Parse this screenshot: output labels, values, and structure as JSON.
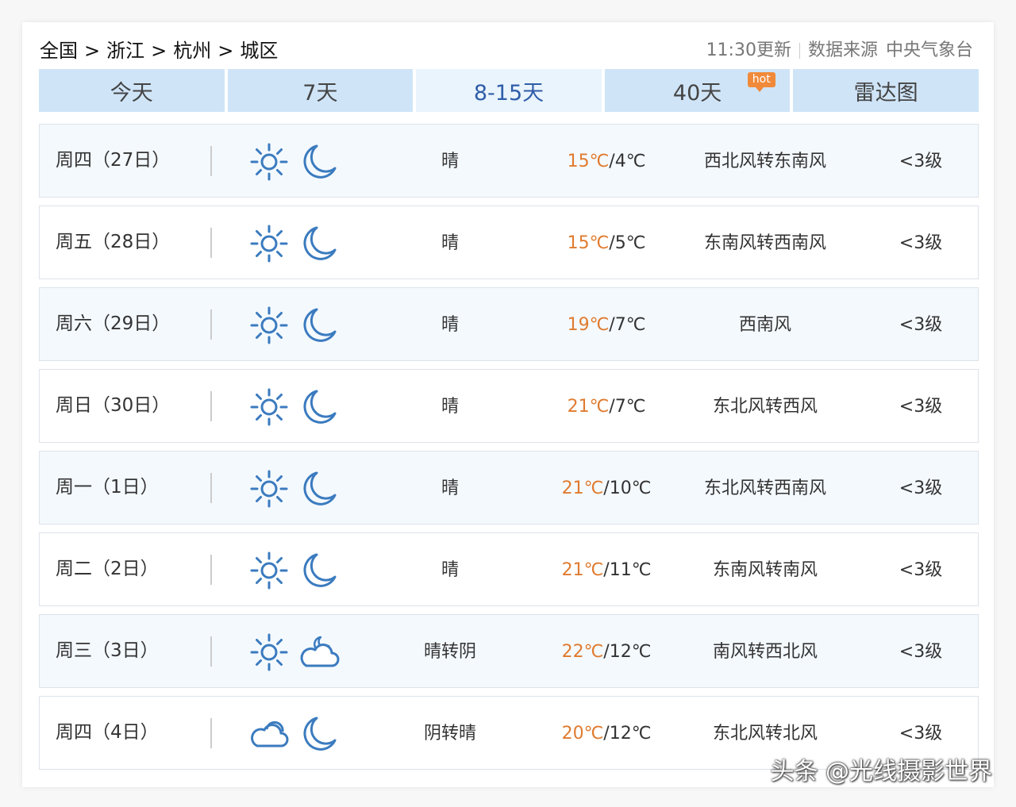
{
  "breadcrumb": {
    "items": [
      "全国",
      "浙江",
      "杭州",
      "城区"
    ],
    "separator": ">"
  },
  "source": {
    "updated": "11:30更新",
    "provider_label": "数据来源",
    "provider": "中央气象台"
  },
  "tabs": [
    {
      "label": "今天",
      "active": false
    },
    {
      "label": "7天",
      "active": false
    },
    {
      "label": "8-15天",
      "active": true
    },
    {
      "label": "40天",
      "active": false,
      "badge": "hot"
    },
    {
      "label": "雷达图",
      "active": false
    }
  ],
  "colors": {
    "accent": "#2f5da8",
    "tab_bg": "#cfe4f7",
    "tab_active_bg": "#eaf4fd",
    "high_temp": "#e07b2f",
    "icon": "#3b7bbf",
    "badge": "#f08a3a"
  },
  "forecast": [
    {
      "date": "周四（27日）",
      "day_icon": "sun-icon",
      "night_icon": "moon-icon",
      "condition": "晴",
      "high": "15℃",
      "low": "4℃",
      "wind": "西北风转东南风",
      "level": "<3级"
    },
    {
      "date": "周五（28日）",
      "day_icon": "sun-icon",
      "night_icon": "moon-icon",
      "condition": "晴",
      "high": "15℃",
      "low": "5℃",
      "wind": "东南风转西南风",
      "level": "<3级"
    },
    {
      "date": "周六（29日）",
      "day_icon": "sun-icon",
      "night_icon": "moon-icon",
      "condition": "晴",
      "high": "19℃",
      "low": "7℃",
      "wind": "西南风",
      "level": "<3级"
    },
    {
      "date": "周日（30日）",
      "day_icon": "sun-icon",
      "night_icon": "moon-icon",
      "condition": "晴",
      "high": "21℃",
      "low": "7℃",
      "wind": "东北风转西风",
      "level": "<3级"
    },
    {
      "date": "周一（1日）",
      "day_icon": "sun-icon",
      "night_icon": "moon-icon",
      "condition": "晴",
      "high": "21℃",
      "low": "10℃",
      "wind": "东北风转西南风",
      "level": "<3级"
    },
    {
      "date": "周二（2日）",
      "day_icon": "sun-icon",
      "night_icon": "moon-icon",
      "condition": "晴",
      "high": "21℃",
      "low": "11℃",
      "wind": "东南风转南风",
      "level": "<3级"
    },
    {
      "date": "周三（3日）",
      "day_icon": "sun-icon",
      "night_icon": "cloudy-night-icon",
      "condition": "晴转阴",
      "high": "22℃",
      "low": "12℃",
      "wind": "南风转西北风",
      "level": "<3级"
    },
    {
      "date": "周四（4日）",
      "day_icon": "cloudy-icon",
      "night_icon": "moon-icon",
      "condition": "阴转晴",
      "high": "20℃",
      "low": "12℃",
      "wind": "东北风转北风",
      "level": "<3级"
    }
  ],
  "watermark": "头条 @光线摄影世界"
}
